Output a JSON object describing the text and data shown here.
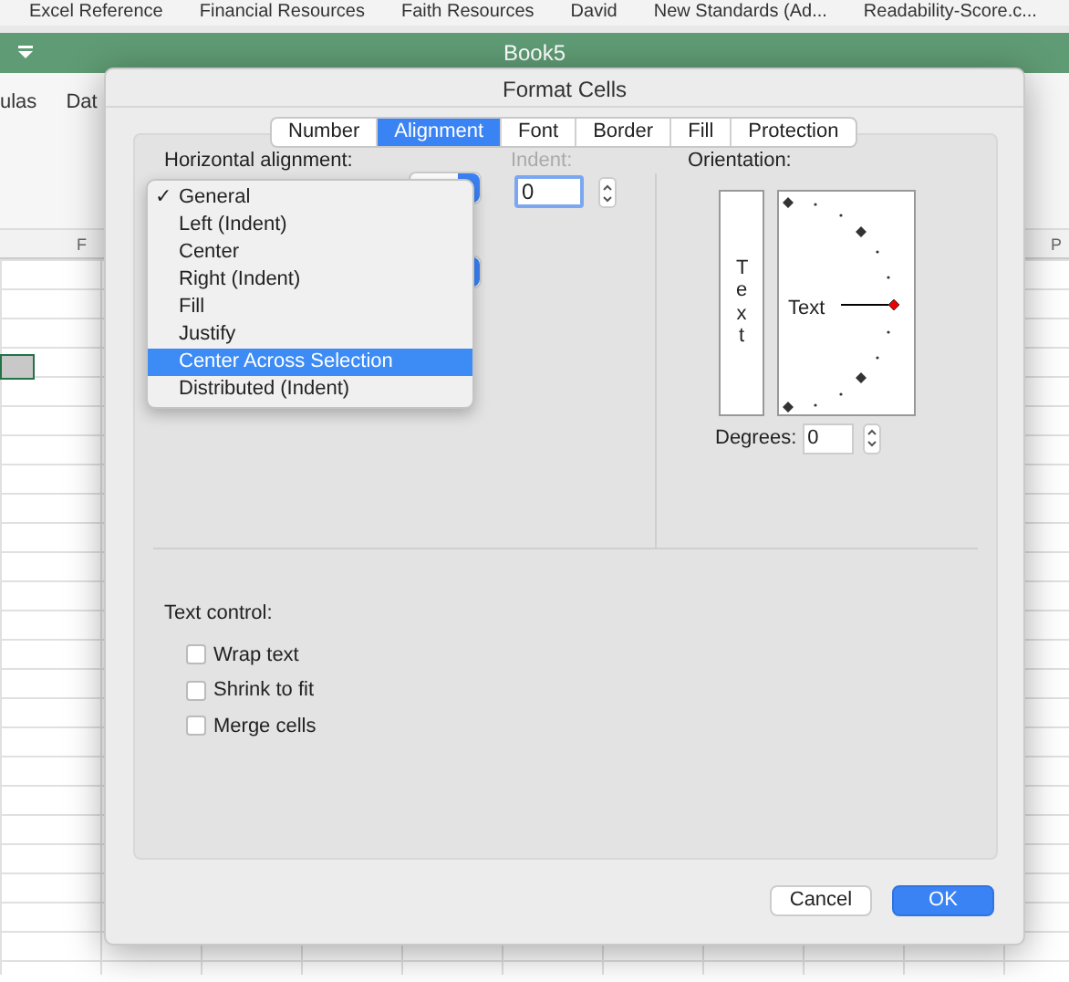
{
  "bookmarks": [
    "Excel Reference",
    "Financial Resources",
    "Faith Resources",
    "David",
    "New Standards (Ad...",
    "Readability-Score.c..."
  ],
  "workbook": {
    "title": "Book5",
    "ribbon_tabs": [
      "ulas",
      "Dat"
    ],
    "column_headers": [
      "F",
      "P"
    ]
  },
  "dialog": {
    "title": "Format Cells",
    "tabs": [
      {
        "label": "Number",
        "selected": false
      },
      {
        "label": "Alignment",
        "selected": true
      },
      {
        "label": "Font",
        "selected": false
      },
      {
        "label": "Border",
        "selected": false
      },
      {
        "label": "Fill",
        "selected": false
      },
      {
        "label": "Protection",
        "selected": false
      }
    ],
    "horizontal_label": "Horizontal alignment:",
    "horizontal_menu": [
      {
        "label": "General",
        "checked": true,
        "selected": false
      },
      {
        "label": "Left (Indent)",
        "checked": false,
        "selected": false
      },
      {
        "label": "Center",
        "checked": false,
        "selected": false
      },
      {
        "label": "Right (Indent)",
        "checked": false,
        "selected": false
      },
      {
        "label": "Fill",
        "checked": false,
        "selected": false
      },
      {
        "label": "Justify",
        "checked": false,
        "selected": false
      },
      {
        "label": "Center Across Selection",
        "checked": false,
        "selected": true
      },
      {
        "label": "Distributed (Indent)",
        "checked": false,
        "selected": false
      }
    ],
    "check_mark": "✓",
    "indent": {
      "label": "Indent:",
      "value": "0",
      "disabled": true
    },
    "orientation": {
      "label": "Orientation:",
      "vertical_text": "Text",
      "dial_text": "Text",
      "degrees_label": "Degrees:",
      "degrees_value": "0"
    },
    "text_control": {
      "label": "Text control:",
      "options": [
        {
          "label": "Wrap text",
          "checked": false
        },
        {
          "label": "Shrink to fit",
          "checked": false
        },
        {
          "label": "Merge cells",
          "checked": false
        }
      ]
    },
    "buttons": [
      {
        "label": "Cancel",
        "kind": "secondary"
      },
      {
        "label": "OK",
        "kind": "primary"
      }
    ]
  }
}
